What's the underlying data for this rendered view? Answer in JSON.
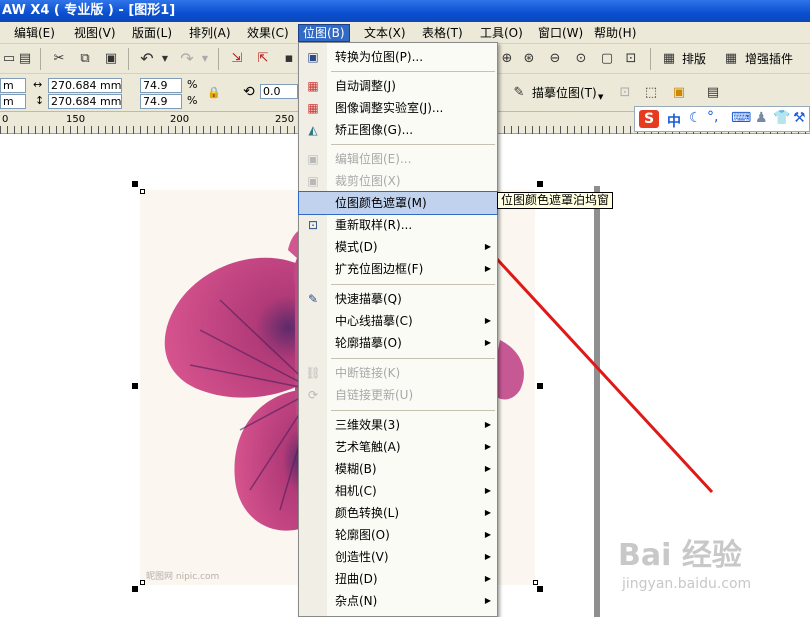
{
  "window": {
    "title": "AW X4 ( 专业版 ) - [图形1]"
  },
  "menubar": [
    "编辑(E)",
    "视图(V)",
    "版面(L)",
    "排列(A)",
    "效果(C)",
    "位图(B)",
    "文本(X)",
    "表格(T)",
    "工具(O)",
    "窗口(W)",
    "帮助(H)"
  ],
  "toolbar": {
    "layout_button": "排版",
    "plugin_button": "增强插件"
  },
  "propertybar": {
    "x_unit": "m",
    "y_unit": "m",
    "width": "270.684 mm",
    "height": "270.684 mm",
    "scale_x": "74.9",
    "scale_y": "74.9",
    "pct": "%",
    "rotation": "0.0",
    "trace_button": "描摹位图(T)"
  },
  "ruler": {
    "labels": [
      "0",
      "150",
      "200",
      "250"
    ]
  },
  "ime": {
    "mode": "中"
  },
  "bitmap_menu": {
    "items": [
      {
        "label": "转换为位图(P)...",
        "icon": "convert-bitmap-icon"
      },
      {
        "label": "自动调整(J)",
        "icon": "auto-adjust-icon"
      },
      {
        "label": "图像调整实验室(J)...",
        "icon": "image-lab-icon"
      },
      {
        "label": "矫正图像(G)...",
        "icon": "straighten-icon"
      },
      {
        "label": "编辑位图(E)...",
        "icon": "edit-bitmap-icon"
      },
      {
        "label": "裁剪位图(X)",
        "icon": "crop-bitmap-icon"
      },
      {
        "label": "位图颜色遮罩(M)",
        "icon": ""
      },
      {
        "label": "重新取样(R)...",
        "icon": "resample-icon"
      },
      {
        "label": "模式(D)",
        "icon": ""
      },
      {
        "label": "扩充位图边框(F)",
        "icon": ""
      },
      {
        "label": "快速描摹(Q)",
        "icon": "quick-trace-icon"
      },
      {
        "label": "中心线描摹(C)",
        "icon": ""
      },
      {
        "label": "轮廓描摹(O)",
        "icon": ""
      },
      {
        "label": "中断链接(K)",
        "icon": "break-link-icon"
      },
      {
        "label": "自链接更新(U)",
        "icon": "update-link-icon"
      },
      {
        "label": "三维效果(3)",
        "icon": ""
      },
      {
        "label": "艺术笔触(A)",
        "icon": ""
      },
      {
        "label": "模糊(B)",
        "icon": ""
      },
      {
        "label": "相机(C)",
        "icon": ""
      },
      {
        "label": "颜色转换(L)",
        "icon": ""
      },
      {
        "label": "轮廓图(O)",
        "icon": ""
      },
      {
        "label": "创造性(V)",
        "icon": ""
      },
      {
        "label": "扭曲(D)",
        "icon": ""
      },
      {
        "label": "杂点(N)",
        "icon": ""
      }
    ],
    "tooltip": "位图颜色遮罩泊坞窗"
  },
  "watermark": {
    "brand": "Bai 经验",
    "url": "jingyan.baidu.com",
    "site": "昵图网 nipic.com"
  }
}
